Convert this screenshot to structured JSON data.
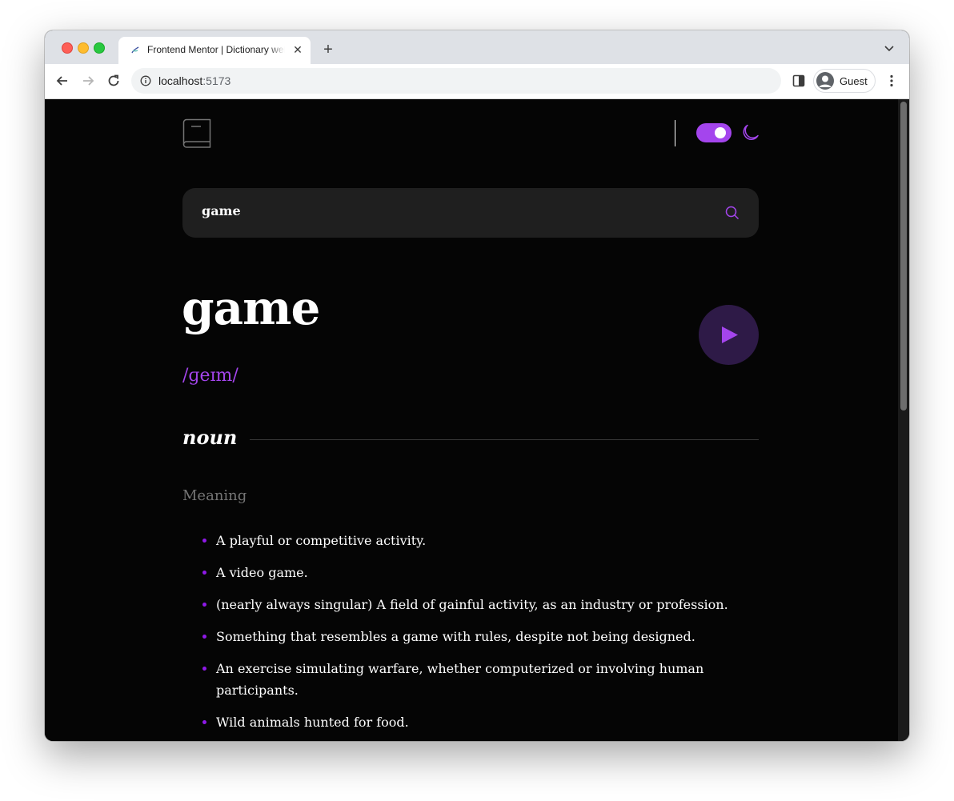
{
  "browser": {
    "tab_title": "Frontend Mentor | Dictionary web app",
    "url_host": "localhost",
    "url_port": ":5173",
    "profile_name": "Guest"
  },
  "colors": {
    "accent": "#a445ed",
    "background": "#050505",
    "search_bg": "#1f1f1f",
    "muted_text": "#757575"
  },
  "header": {
    "logo_icon": "book-icon",
    "theme_toggle": {
      "state": "dark",
      "icon": "moon-icon"
    }
  },
  "search": {
    "value": "game",
    "icon": "search-icon"
  },
  "entry": {
    "word": "game",
    "phonetic": "/ɡeɪm/",
    "play_icon": "play-icon"
  },
  "meaning": {
    "part_of_speech": "noun",
    "label": "Meaning",
    "definitions": [
      "A playful or competitive activity.",
      "A video game.",
      "(nearly always singular) A field of gainful activity, as an industry or profession.",
      "Something that resembles a game with rules, despite not being designed.",
      "An exercise simulating warfare, whether computerized or involving human participants.",
      "Wild animals hunted for food."
    ]
  }
}
